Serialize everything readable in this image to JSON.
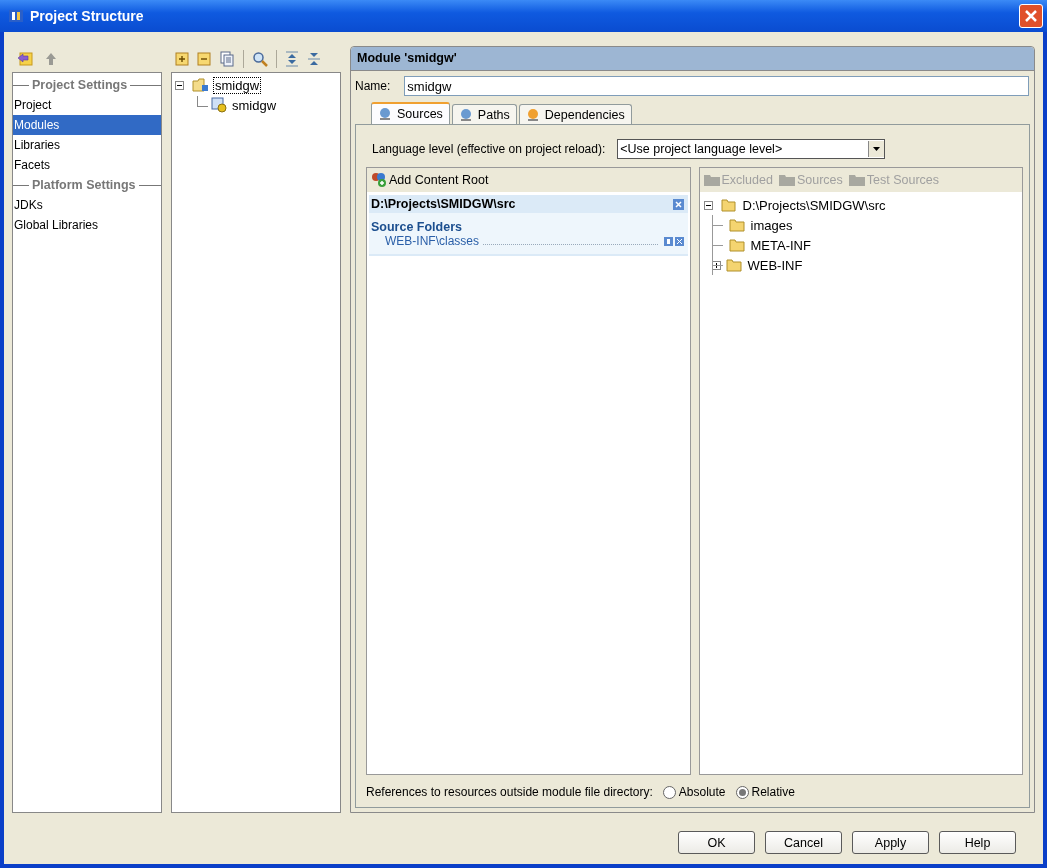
{
  "window": {
    "title": "Project Structure"
  },
  "sidebar": {
    "items": [
      {
        "kind": "header",
        "label": "Project Settings"
      },
      {
        "kind": "item",
        "label": "Project",
        "selected": false
      },
      {
        "kind": "item",
        "label": "Modules",
        "selected": true
      },
      {
        "kind": "item",
        "label": "Libraries",
        "selected": false
      },
      {
        "kind": "item",
        "label": "Facets",
        "selected": false
      },
      {
        "kind": "header",
        "label": "Platform Settings"
      },
      {
        "kind": "item",
        "label": "JDKs",
        "selected": false
      },
      {
        "kind": "item",
        "label": "Global Libraries",
        "selected": false
      }
    ]
  },
  "module_tree": [
    {
      "label": "smidgw",
      "expanded": true,
      "selected": true,
      "children": [
        {
          "label": "smidgw",
          "selected": false
        }
      ]
    }
  ],
  "panel": {
    "title": "Module 'smidgw'",
    "name_label": "Name:",
    "name_value": "smidgw",
    "tabs": [
      {
        "label": "Sources",
        "selected": true
      },
      {
        "label": "Paths",
        "selected": false
      },
      {
        "label": "Dependencies",
        "selected": false
      }
    ],
    "language_label": "Language level (effective on project reload):",
    "language_value": "<Use project language level>",
    "add_content_root": "Add Content Root",
    "root_path": "D:\\Projects\\SMIDGW\\src",
    "section_title": "Source Folders",
    "folders": [
      "WEB-INF\\classes"
    ],
    "mark_buttons": [
      {
        "label": "Excluded",
        "disabled": true
      },
      {
        "label": "Sources",
        "disabled": true
      },
      {
        "label": "Test Sources",
        "disabled": true
      }
    ],
    "folder_tree": {
      "label": "D:\\Projects\\SMIDGW\\src",
      "expanded": true,
      "children": [
        {
          "label": "images",
          "expandable": false
        },
        {
          "label": "META-INF",
          "expandable": false
        },
        {
          "label": "WEB-INF",
          "expandable": true
        }
      ]
    },
    "references_label": "References to resources outside module file directory:",
    "reference_options": [
      {
        "label": "Absolute",
        "selected": false
      },
      {
        "label": "Relative",
        "selected": true
      }
    ]
  },
  "buttons": [
    "OK",
    "Cancel",
    "Apply",
    "Help"
  ]
}
